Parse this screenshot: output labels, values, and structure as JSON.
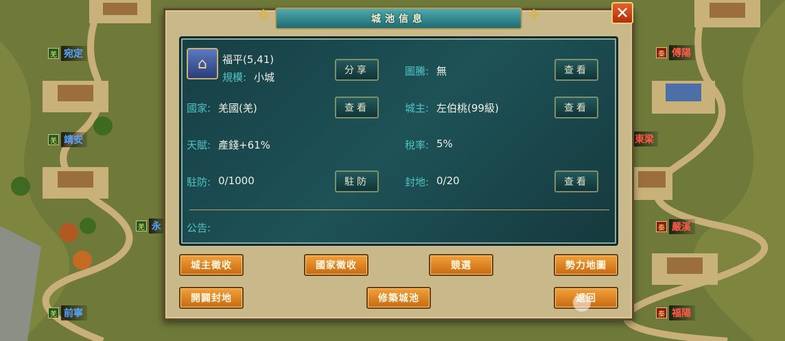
{
  "map": {
    "labels": [
      {
        "flag": "羌",
        "name": "宛定",
        "flag_color": "green",
        "name_color": "blue"
      },
      {
        "flag": "羌",
        "name": "靖安",
        "flag_color": "green",
        "name_color": "blue"
      },
      {
        "flag": "羌",
        "name": "永",
        "flag_color": "green",
        "name_color": "blue"
      },
      {
        "flag": "羌",
        "name": "前寧",
        "flag_color": "green",
        "name_color": "blue"
      },
      {
        "flag": "秦",
        "name": "傅陽",
        "flag_color": "red",
        "name_color": "red"
      },
      {
        "flag": "",
        "name": "東梁",
        "flag_color": "red",
        "name_color": "red"
      },
      {
        "flag": "秦",
        "name": "嚴溪",
        "flag_color": "red",
        "name_color": "red"
      },
      {
        "flag": "秦",
        "name": "福陽",
        "flag_color": "red",
        "name_color": "red"
      }
    ]
  },
  "panel": {
    "title": "城池信息",
    "close_icon": "close-icon",
    "city": {
      "name": "福平(5,41)",
      "scale_label": "規模:",
      "scale_value": "小城",
      "icon": "city-icon"
    },
    "rows": {
      "totem_label": "圖騰:",
      "totem_value": "無",
      "nation_label": "國家:",
      "nation_value": "羌國(羌)",
      "lord_label": "城主:",
      "lord_value": "左伯桃(99級)",
      "talent_label": "天賦:",
      "talent_value": "產錢+61%",
      "tax_label": "稅率:",
      "tax_value": "5%",
      "garrison_label": "駐防:",
      "garrison_value": "0/1000",
      "fief_label": "封地:",
      "fief_value": "0/20",
      "notice_label": "公告:"
    },
    "buttons": {
      "share": "分享",
      "view_totem": "查看",
      "view_nation": "查看",
      "view_lord": "查看",
      "garrison": "駐防",
      "view_fief": "查看",
      "lord_levy": "城主徵收",
      "nation_levy": "國家徵收",
      "election": "競選",
      "power_map": "勢力地圖",
      "open_fief": "開闢封地",
      "build_city": "修築城池",
      "back": "返回"
    }
  },
  "colors": {
    "label_teal": "#4fc4c4",
    "value_white": "#f0f0e6",
    "button_orange": "#e08a26",
    "info_bg": "#1d5257"
  }
}
